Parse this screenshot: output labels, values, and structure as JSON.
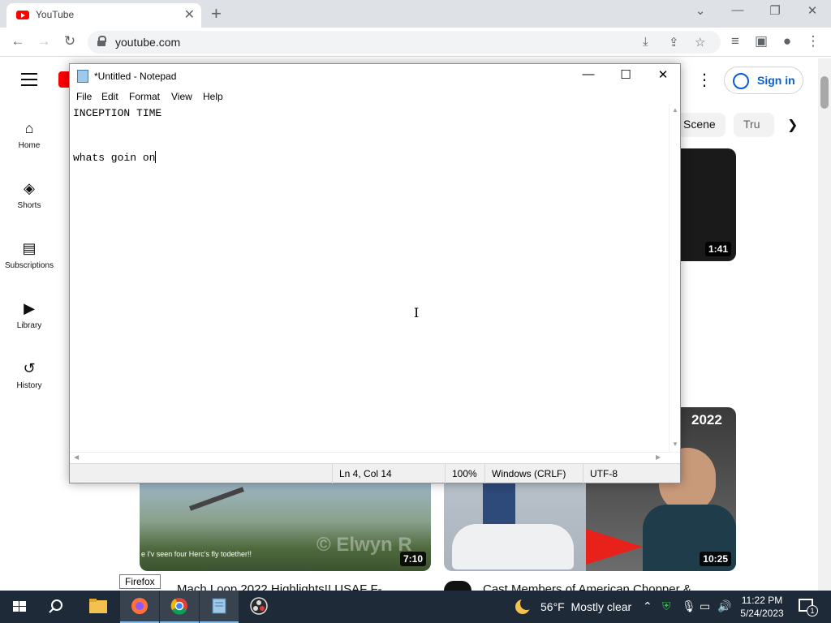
{
  "browser": {
    "tab_title": "YouTube",
    "url": "youtube.com"
  },
  "youtube": {
    "sidebar": [
      {
        "label": "Home",
        "icon": "home-icon"
      },
      {
        "label": "Shorts",
        "icon": "shorts-icon"
      },
      {
        "label": "Subscriptions",
        "icon": "subscriptions-icon"
      },
      {
        "label": "Library",
        "icon": "library-icon"
      },
      {
        "label": "History",
        "icon": "history-icon"
      }
    ],
    "sign_in": "Sign in",
    "chips": [
      "Scene",
      "Tru"
    ],
    "videos": [
      {
        "duration": "1:41"
      },
      {
        "duration": "7:10",
        "overlay_text": "e I'v seen four Herc's fly todether!!",
        "watermark": "© Elwyn R",
        "title": "Mach Loop 2022 Highlights!! USAF F-"
      },
      {
        "duration": "10:25",
        "year_badge": "2022",
        "title": "Cast Members of American Chopper &"
      }
    ]
  },
  "notepad": {
    "title": "*Untitled - Notepad",
    "menu": [
      "File",
      "Edit",
      "Format",
      "View",
      "Help"
    ],
    "lines": [
      "INCEPTION TIME",
      "",
      "whats goin on"
    ],
    "status": {
      "position": "Ln 4, Col 14",
      "zoom": "100%",
      "line_ending": "Windows (CRLF)",
      "encoding": "UTF-8"
    }
  },
  "taskbar": {
    "tooltip": "Firefox",
    "weather": "56°F  Mostly clear",
    "time": "11:22 PM",
    "date": "5/24/2023",
    "notification_count": "1"
  }
}
